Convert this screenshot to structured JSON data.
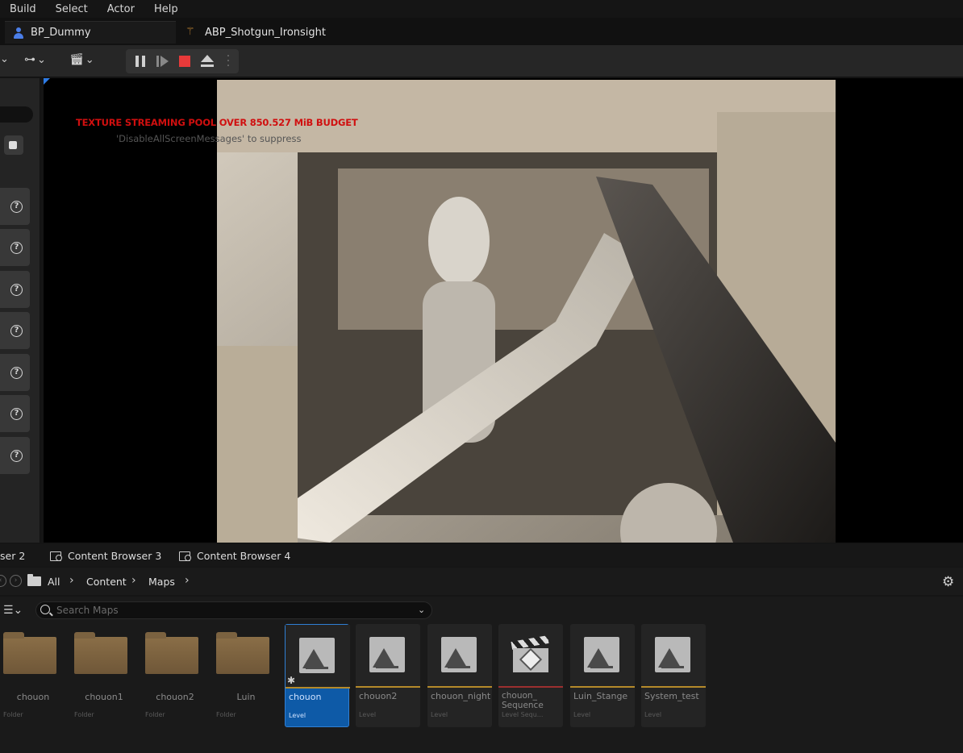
{
  "menu": [
    "Build",
    "Select",
    "Actor",
    "Help"
  ],
  "tabs": [
    {
      "label": "BP_Dummy",
      "icon": "person-icon"
    },
    {
      "label": "ABP_Shotgun_Ironsight",
      "icon": "animation-icon"
    }
  ],
  "toolbar": {
    "icons": [
      "chevron-down-icon",
      "hierarchy-icon",
      "clapper-icon",
      "pause-icon",
      "step-icon",
      "stop-icon",
      "eject-icon",
      "more-icon"
    ],
    "stop_color": "#e83a3a"
  },
  "viewport": {
    "warning": "TEXTURE STREAMING POOL OVER 850.527 MiB BUDGET",
    "warning_sub": "'DisableAllScreenMessages' to suppress",
    "warning_color": "#d00f0f"
  },
  "content_tabs": [
    "ser 2",
    "Content Browser 3",
    "Content Browser 4"
  ],
  "breadcrumb": [
    "All",
    "Content",
    "Maps"
  ],
  "search": {
    "placeholder": "Search Maps",
    "value": ""
  },
  "assets": [
    {
      "name": "chouon",
      "type": "Folder",
      "kind": "folder"
    },
    {
      "name": "chouon1",
      "type": "Folder",
      "kind": "folder"
    },
    {
      "name": "chouon2",
      "type": "Folder",
      "kind": "folder"
    },
    {
      "name": "Luin",
      "type": "Folder",
      "kind": "folder"
    },
    {
      "name": "chouon",
      "type": "Level",
      "kind": "level",
      "selected": true
    },
    {
      "name": "chouon2",
      "type": "Level",
      "kind": "level"
    },
    {
      "name": "chouon_night",
      "type": "Level",
      "kind": "level"
    },
    {
      "name": "chouon_\nSequence",
      "type": "Level Sequ...",
      "kind": "sequence"
    },
    {
      "name": "Luin_Stange",
      "type": "Level",
      "kind": "level"
    },
    {
      "name": "System_test",
      "type": "Level",
      "kind": "level"
    }
  ],
  "accent_color": "#0e5aa7"
}
